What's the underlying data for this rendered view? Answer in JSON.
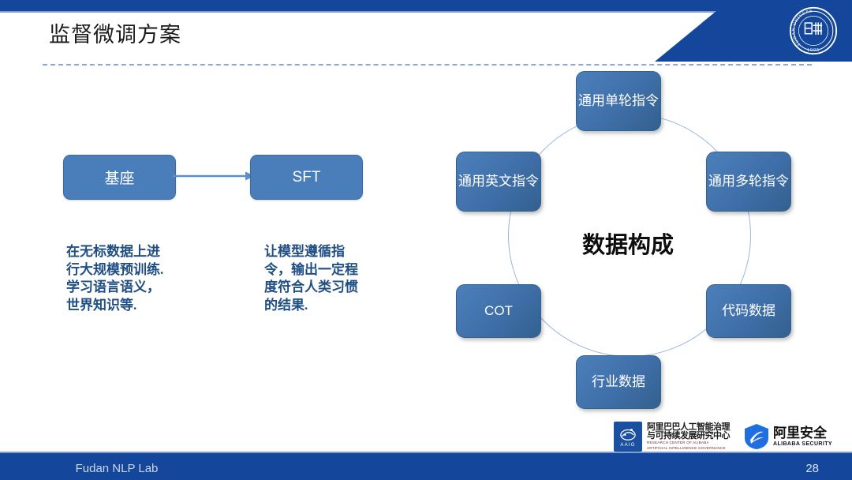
{
  "slide": {
    "title": "监督微调方案",
    "page_number": "28",
    "footer_label": "Fudan NLP Lab",
    "colors": {
      "header_blue": "#14479c",
      "accent_rule": "#7f9dd0",
      "box_blue": "#4a7ebb",
      "node_blue": "#3f6fa8",
      "caption_blue": "#1f4e85",
      "ring_blue": "#9bb7dc"
    }
  },
  "brand": {
    "seal_name": "fudan-university-seal",
    "seal_text_top": "FUDAN UNIVERSITY",
    "seal_year": "1905"
  },
  "flow": {
    "boxes": [
      {
        "id": "base",
        "label": "基座"
      },
      {
        "id": "sft",
        "label": "SFT"
      }
    ],
    "arrow_name": "flow-arrow-base-to-sft",
    "captions": [
      {
        "id": "base",
        "text": "在无标数据上进行大规模预训练. 学习语言语义，世界知识等."
      },
      {
        "id": "sft",
        "text": "让模型遵循指令，输出一定程度符合人类习惯的结果."
      }
    ]
  },
  "cycle": {
    "center_label": "数据构成",
    "nodes": [
      {
        "id": "single-turn",
        "label": "通用单轮指令"
      },
      {
        "id": "multi-turn",
        "label": "通用多轮指令"
      },
      {
        "id": "code-data",
        "label": "代码数据"
      },
      {
        "id": "industry-data",
        "label": "行业数据"
      },
      {
        "id": "cot",
        "label": "COT"
      },
      {
        "id": "english-instruction",
        "label": "通用英文指令"
      }
    ]
  },
  "logos": {
    "aaig": {
      "mark_label": "AAIG",
      "cn_line1": "阿里巴巴人工智能治理",
      "cn_line2": "与可持续发展研究中心",
      "en_line1": "RESEARCH CENTER OF ALIBABA",
      "en_line2": "ARTIFICIAL INTELLIGENCE GOVERNANCE"
    },
    "alibaba_security": {
      "cn": "阿里安全",
      "en": "ALIBABA SECURITY"
    }
  }
}
